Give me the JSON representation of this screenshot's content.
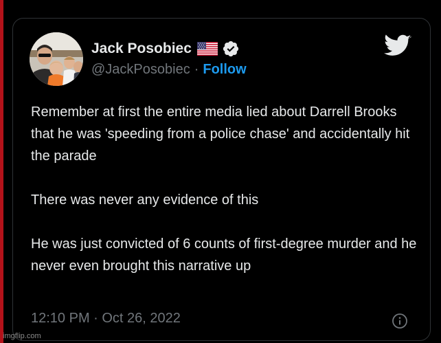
{
  "tweet": {
    "author": {
      "display_name": "Jack Posobiec",
      "handle": "@JackPosobiec",
      "flag_icon": "us-flag-icon",
      "verified_icon": "verified-badge-icon"
    },
    "separator": "·",
    "follow_label": "Follow",
    "text": "Remember at first the entire media lied about Darrell Brooks that he was 'speeding from a police chase' and accidentally hit the parade\n\nThere was never any evidence of this\n\nHe was just convicted of 6 counts of first-degree murder and he never even brought this narrative up",
    "timestamp": "12:10 PM · Oct 26, 2022",
    "brand_icon": "twitter-bird-icon",
    "info_icon": "info-icon"
  },
  "watermark": "imgflip.com",
  "colors": {
    "background": "#000000",
    "text_primary": "#e7e9ea",
    "text_secondary": "#71767b",
    "accent": "#1d9bf0",
    "border": "#2f3336",
    "left_edge": "#b3121a"
  }
}
